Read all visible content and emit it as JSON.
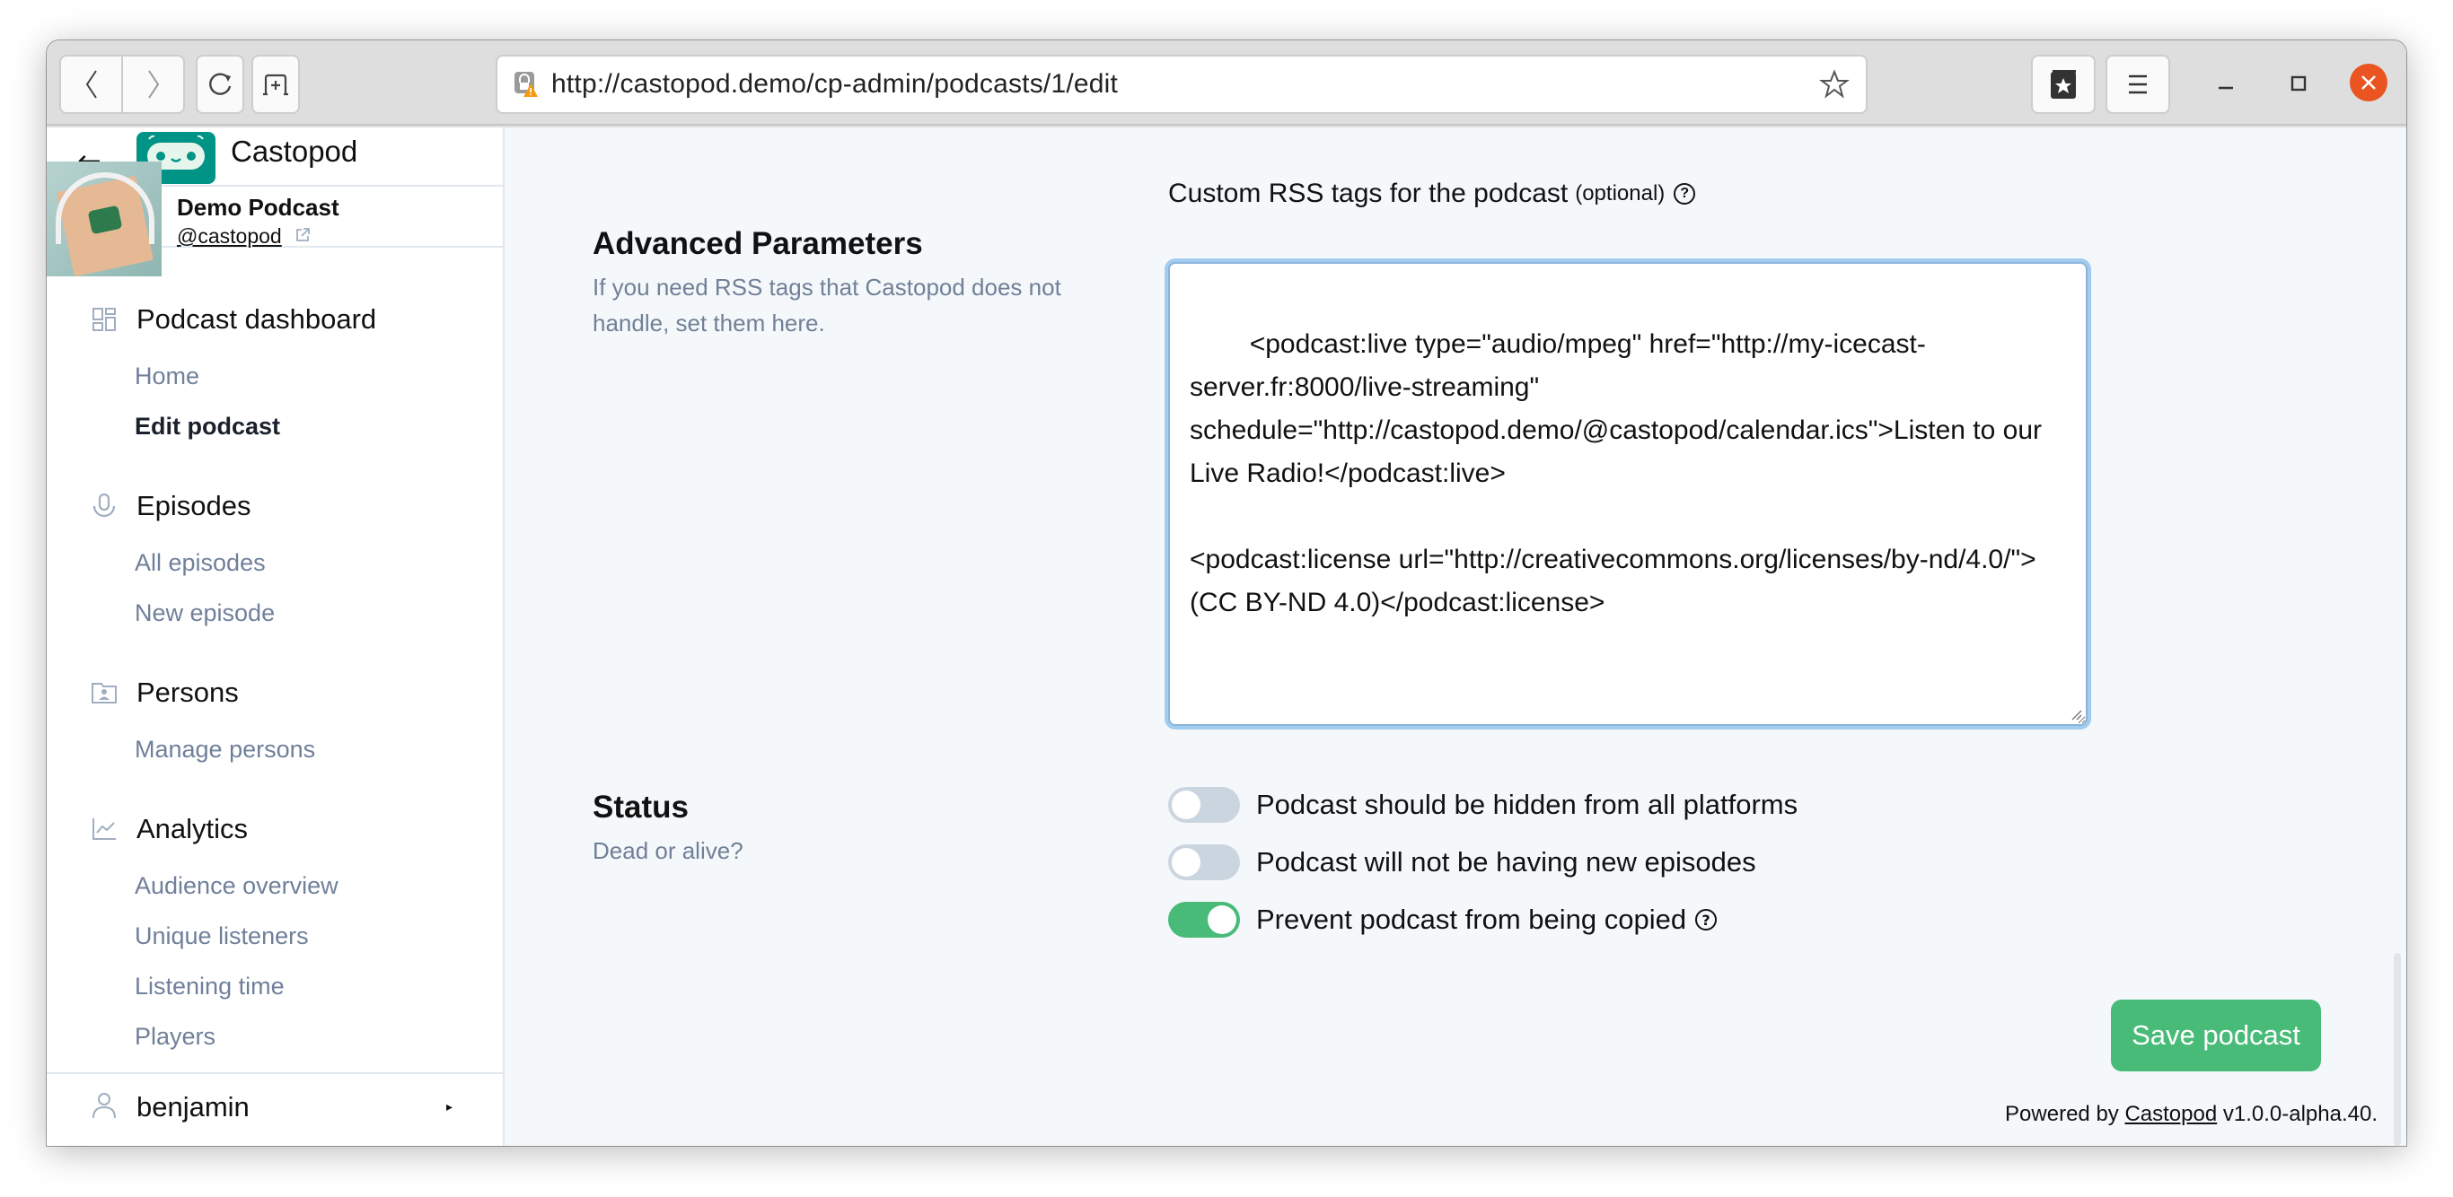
{
  "browser": {
    "url": "http://castopod.demo/cp-admin/podcasts/1/edit",
    "icons": {
      "back": "chevron-left-icon",
      "forward": "chevron-right-icon",
      "reload": "reload-icon",
      "new_tab": "new-tab-icon",
      "site_security": "insecure-lock-icon",
      "bookmark": "star-icon",
      "library": "bookmarks-library-icon",
      "menu": "hamburger-menu-icon",
      "minimize": "minimize-icon",
      "maximize": "maximize-icon",
      "close": "close-icon"
    },
    "accent_close": "#e95420"
  },
  "sidebar": {
    "back_arrow": "←",
    "brand": "Castopod",
    "podcast": {
      "title": "Demo Podcast",
      "handle": "@castopod"
    },
    "sections": [
      {
        "label": "Podcast dashboard",
        "icon": "dashboard-icon",
        "items": [
          {
            "label": "Home",
            "active": false
          },
          {
            "label": "Edit podcast",
            "active": true
          }
        ]
      },
      {
        "label": "Episodes",
        "icon": "microphone-icon",
        "items": [
          {
            "label": "All episodes",
            "active": false
          },
          {
            "label": "New episode",
            "active": false
          }
        ]
      },
      {
        "label": "Persons",
        "icon": "persons-folder-icon",
        "items": [
          {
            "label": "Manage persons",
            "active": false
          }
        ]
      },
      {
        "label": "Analytics",
        "icon": "line-chart-icon",
        "items": [
          {
            "label": "Audience overview",
            "active": false
          },
          {
            "label": "Unique listeners",
            "active": false
          },
          {
            "label": "Listening time",
            "active": false
          },
          {
            "label": "Players",
            "active": false
          }
        ]
      }
    ],
    "user": {
      "name": "benjamin",
      "caret": "▸"
    }
  },
  "main": {
    "advanced": {
      "title": "Advanced Parameters",
      "description": "If you need RSS tags that Castopod does not handle, set them here.",
      "field_label": "Custom RSS tags for the podcast",
      "field_optional": "(optional)",
      "help": "?",
      "value": "<podcast:live type=\"audio/mpeg\" href=\"http://my-icecast-server.fr:8000/live-streaming\" schedule=\"http://castopod.demo/@castopod/calendar.ics\">Listen to our Live Radio!</podcast:live>\n\n<podcast:license url=\"http://creativecommons.org/licenses/by-nd/4.0/\">(CC BY-ND 4.0)</podcast:license>"
    },
    "status": {
      "title": "Status",
      "description": "Dead or alive?",
      "toggles": [
        {
          "label": "Podcast should be hidden from all platforms",
          "checked": false
        },
        {
          "label": "Podcast will not be having new episodes",
          "checked": false
        },
        {
          "label": "Prevent podcast from being copied",
          "checked": true,
          "help": "?"
        }
      ]
    },
    "save_label": "Save podcast",
    "footer": {
      "prefix": "Powered by ",
      "link": "Castopod",
      "suffix": " v1.0.0-alpha.40."
    },
    "colors": {
      "primary_green": "#48bb78",
      "brand_teal": "#009486",
      "focus_ring": "#a3cdf0",
      "muted_text": "#718096"
    }
  }
}
